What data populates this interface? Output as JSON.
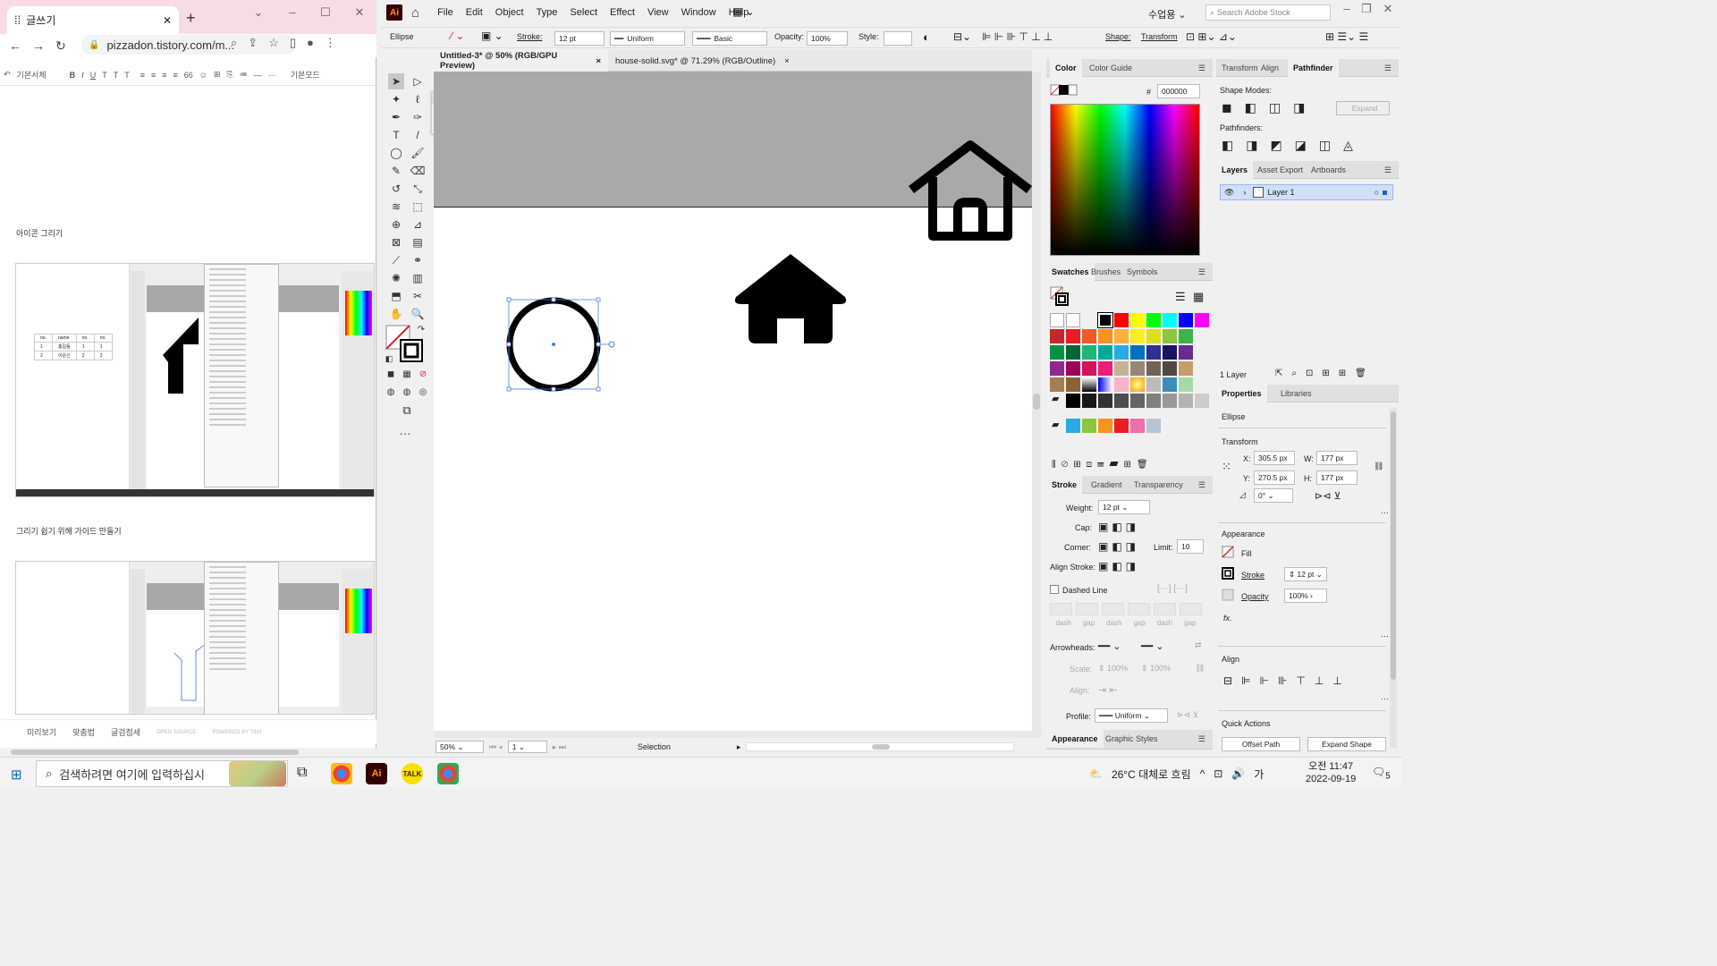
{
  "chrome": {
    "tab_title": "글쓰기",
    "tab_favicon": "tistory-icon",
    "new_tab": "+",
    "window_controls": [
      "⌄",
      "–",
      "☐",
      "✕"
    ],
    "url": "pizzadon.tistory.com/m...",
    "editor_toolbar": [
      "↶",
      "기본서체",
      "B",
      "I",
      "U",
      "T",
      "T",
      "T",
      "≡",
      "≡",
      "≡",
      "≡",
      "66",
      "☺",
      "⊞",
      "⎘",
      "≔",
      "—",
      "···",
      "기본모드"
    ],
    "blog_text_1": "아이콘 그리기",
    "blog_text_2": "그리기 쉽기 위해 가이드 만들기",
    "shot_table": [
      [
        "no.",
        "name",
        "no.",
        "no."
      ],
      [
        "1",
        "홍길동",
        "1",
        "1"
      ],
      [
        "2",
        "이순신",
        "2",
        "2"
      ]
    ],
    "footer": {
      "preview": "미리보기",
      "spellcheck": "맞춤법",
      "inspect": "글검점세",
      "open_source": "OPEN SOURCE",
      "powered": "POWERED BY TINY"
    }
  },
  "ai": {
    "logo": "Ai",
    "menus": [
      "File",
      "Edit",
      "Object",
      "Type",
      "Select",
      "Effect",
      "View",
      "Window",
      "Help"
    ],
    "user": "수업용",
    "search_placeholder": "Search Adobe Stock",
    "control": {
      "object": "Ellipse",
      "stroke_label": "Stroke:",
      "stroke_value": "12 pt",
      "profile": "Uniform",
      "brush": "Basic",
      "opacity_label": "Opacity:",
      "opacity_value": "100%",
      "style_label": "Style:",
      "shape_label": "Shape:",
      "transform_label": "Transform"
    },
    "doc_tabs": [
      {
        "label": "Untitled-3* @ 50% (RGB/GPU Preview)",
        "close": "×"
      },
      {
        "label": "house-solid.svg* @ 71.29% (RGB/Outline)",
        "close": "×"
      }
    ],
    "status": {
      "zoom": "50%",
      "artboard": "1",
      "tool": "Selection"
    },
    "color_panel": {
      "tabs": [
        "Color",
        "Color Guide"
      ],
      "hash": "#",
      "hex": "000000"
    },
    "swatches_panel": {
      "tabs": [
        "Swatches",
        "Brushes",
        "Symbols"
      ]
    },
    "stroke_panel": {
      "tabs": [
        "Stroke",
        "Gradient",
        "Transparency"
      ],
      "weight_label": "Weight:",
      "weight_value": "12 pt",
      "cap_label": "Cap:",
      "corner_label": "Corner:",
      "limit_label": "Limit:",
      "limit_value": "10",
      "align_label": "Align Stroke:",
      "dashed_label": "Dashed Line",
      "dash_labels": [
        "dash",
        "gap",
        "dash",
        "gap",
        "dash",
        "gap"
      ],
      "arrowheads_label": "Arrowheads:",
      "scale_label": "Scale:",
      "scale_a": "100%",
      "scale_b": "100%",
      "align2_label": "Align:",
      "profile_label": "Profile:",
      "profile_value": "Uniform"
    },
    "bottom_tabs": [
      "Appearance",
      "Graphic Styles"
    ],
    "pathfinder_panel": {
      "tabs": [
        "Transform",
        "Align",
        "Pathfinder"
      ],
      "shape_modes": "Shape Modes:",
      "expand": "Expand",
      "pathfinders": "Pathfinders:"
    },
    "layers_panel": {
      "tabs": [
        "Layers",
        "Asset Export",
        "Artboards"
      ],
      "layer_name": "Layer 1",
      "count": "1 Layer"
    },
    "properties_panel": {
      "tabs": [
        "Properties",
        "Libraries"
      ],
      "object": "Ellipse",
      "transform": "Transform",
      "x_label": "X:",
      "x": "305.5 px",
      "y_label": "Y:",
      "y": "270.5 px",
      "w_label": "W:",
      "w": "177 px",
      "h_label": "H:",
      "h": "177 px",
      "angle": "0°",
      "appearance": "Appearance",
      "fill": "Fill",
      "stroke": "Stroke",
      "stroke_value": "12 pt",
      "opacity": "Opacity",
      "opacity_value": "100%",
      "fx": "fx.",
      "align": "Align",
      "quick_actions": "Quick Actions",
      "offset_path": "Offset Path",
      "expand_shape": "Expand Shape"
    }
  },
  "taskbar": {
    "search_placeholder": "검색하려면 여기에 입력하십시",
    "apps": [
      {
        "label": "",
        "color": "#4285f4"
      },
      {
        "label": "Ai",
        "color": "#330000"
      },
      {
        "label": "TALK",
        "color": "#f9e000"
      },
      {
        "label": "",
        "color": "#4285f4"
      }
    ],
    "weather": "26°C 대체로 흐림",
    "tray_icons": [
      "^",
      "⊡",
      "🔊",
      "가"
    ],
    "time": "오전 11:47",
    "date": "2022-09-19",
    "notifications": "5"
  },
  "colors": {
    "accent_ai": "#ff9a00",
    "selection": "#4a7fe0",
    "chrome_tab": "#f7dce6"
  }
}
